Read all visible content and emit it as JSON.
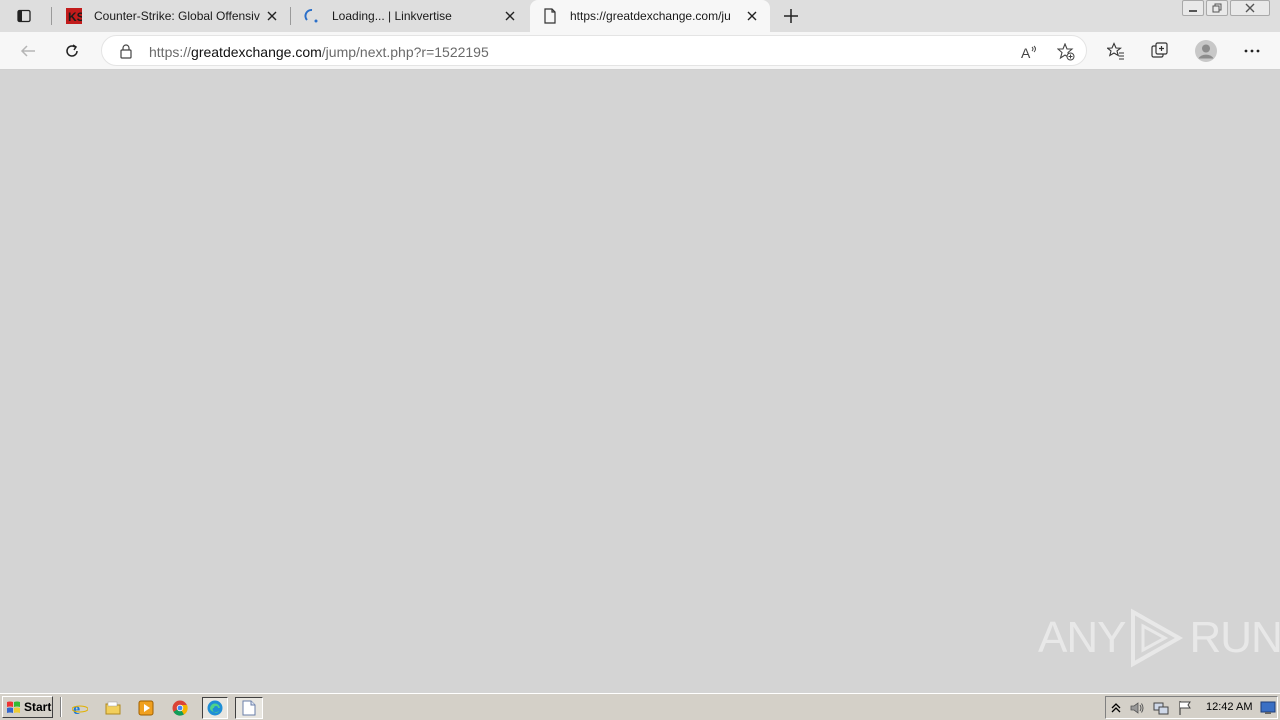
{
  "browser": {
    "tabs": [
      {
        "title": "Counter-Strike: Global Offensiv",
        "favicon": "cs-logo-icon",
        "active": false
      },
      {
        "title": "Loading... | Linkvertise",
        "favicon": "loading-spinner-icon",
        "active": false
      },
      {
        "title": "https://greatdexchange.com/ju",
        "favicon": "page-icon",
        "active": true
      }
    ],
    "address": {
      "scheme": "https://",
      "host": "greatdexchange.com",
      "path": "/jump/next.php?r=1522195"
    }
  },
  "watermark": {
    "text_left": "ANY",
    "text_right": "RUN"
  },
  "taskbar": {
    "start_label": "Start",
    "quick_launch": [
      "ie-icon",
      "folder-icon",
      "media-player-icon",
      "chrome-icon",
      "edge-icon",
      "notepad-icon"
    ],
    "clock": "12:42 AM"
  },
  "colors": {
    "content_bg": "#d4d4d4",
    "tab_active": "#f7f7f7",
    "taskbar": "#d4d0c8"
  }
}
